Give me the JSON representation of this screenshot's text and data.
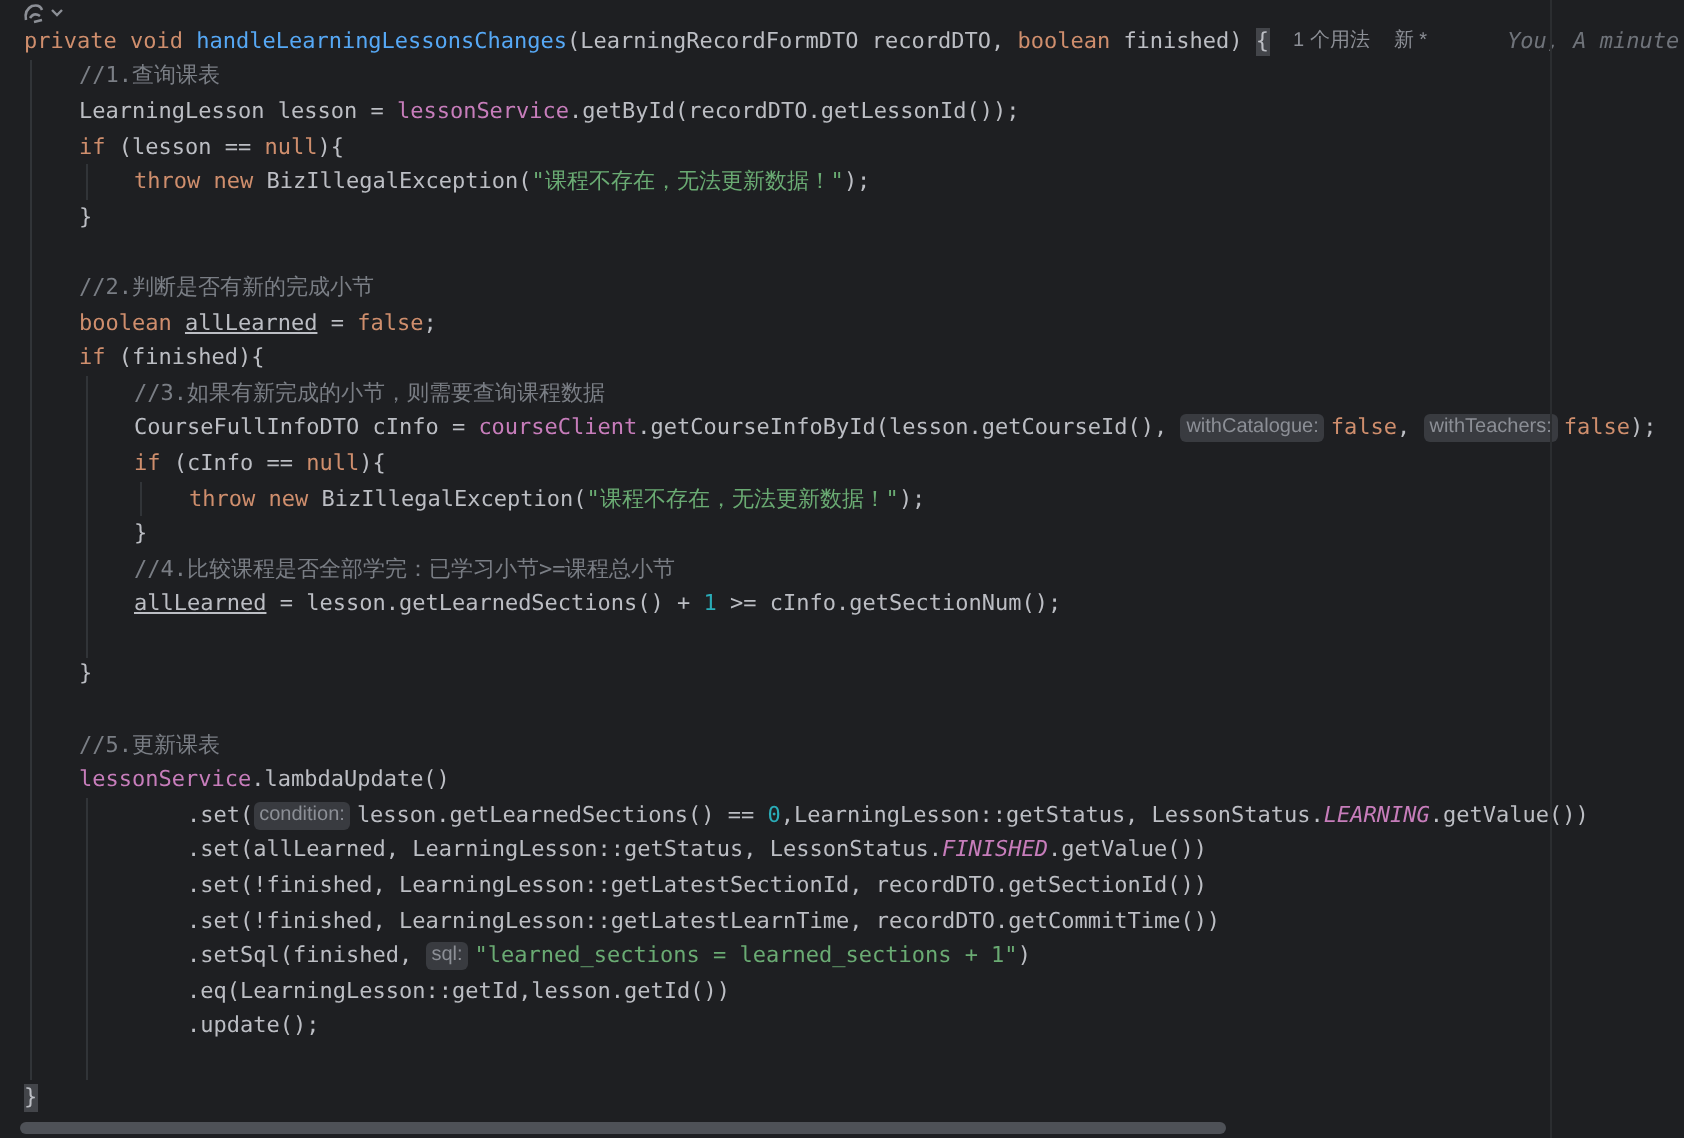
{
  "lines": [
    {
      "tokens": [
        {
          "kind": "kw",
          "text": "private void "
        },
        {
          "kind": "fn",
          "text": "handleLearningLessonsChanges"
        },
        {
          "kind": "plain",
          "text": "(LearningRecordFormDTO recordDTO, "
        },
        {
          "kind": "kw",
          "text": "boolean "
        },
        {
          "kind": "plain",
          "text": "finished) "
        },
        {
          "kind": "brace",
          "text": "{"
        },
        {
          "kind": "lens",
          "text": "1 个用法"
        },
        {
          "kind": "lens",
          "text": "新 *"
        },
        {
          "kind": "blame",
          "text": "You, A minute"
        }
      ],
      "children": [
        {
          "tokens": [
            {
              "kind": "cmt",
              "text": "//1.查询课表"
            }
          ]
        },
        {
          "tokens": [
            {
              "kind": "plain",
              "text": "LearningLesson lesson = "
            },
            {
              "kind": "field",
              "text": "lessonService"
            },
            {
              "kind": "plain",
              "text": ".getById(recordDTO.getLessonId());"
            }
          ]
        },
        {
          "tokens": [
            {
              "kind": "kw",
              "text": "if "
            },
            {
              "kind": "plain",
              "text": "(lesson == "
            },
            {
              "kind": "kw",
              "text": "null"
            },
            {
              "kind": "plain",
              "text": "){"
            }
          ],
          "children": [
            {
              "tokens": [
                {
                  "kind": "kw",
                  "text": "throw new "
                },
                {
                  "kind": "plain",
                  "text": "BizIllegalException("
                },
                {
                  "kind": "str",
                  "text": "\"课程不存在，无法更新数据！\""
                },
                {
                  "kind": "plain",
                  "text": ");"
                }
              ]
            }
          ]
        },
        {
          "tokens": [
            {
              "kind": "plain",
              "text": "}"
            }
          ]
        },
        {
          "kind": "blank"
        },
        {
          "tokens": [
            {
              "kind": "cmt",
              "text": "//2.判断是否有新的完成小节"
            }
          ]
        },
        {
          "tokens": [
            {
              "kind": "kw",
              "text": "boolean "
            },
            {
              "kind": "var",
              "text": "allLearned"
            },
            {
              "kind": "plain",
              "text": " = "
            },
            {
              "kind": "kw",
              "text": "false"
            },
            {
              "kind": "plain",
              "text": ";"
            }
          ]
        },
        {
          "tokens": [
            {
              "kind": "kw",
              "text": "if "
            },
            {
              "kind": "plain",
              "text": "(finished){"
            }
          ],
          "children": [
            {
              "tokens": [
                {
                  "kind": "cmt",
                  "text": "//3.如果有新完成的小节，则需要查询课程数据"
                }
              ]
            },
            {
              "tokens": [
                {
                  "kind": "plain",
                  "text": "CourseFullInfoDTO cInfo = "
                },
                {
                  "kind": "field",
                  "text": "courseClient"
                },
                {
                  "kind": "plain",
                  "text": ".getCourseInfoById(lesson.getCourseId(), "
                },
                {
                  "kind": "hint",
                  "text": "withCatalogue:"
                },
                {
                  "kind": "kw",
                  "text": "false"
                },
                {
                  "kind": "plain",
                  "text": ", "
                },
                {
                  "kind": "hint",
                  "text": "withTeachers:"
                },
                {
                  "kind": "kw",
                  "text": "false"
                },
                {
                  "kind": "plain",
                  "text": ");"
                }
              ]
            },
            {
              "tokens": [
                {
                  "kind": "kw",
                  "text": "if "
                },
                {
                  "kind": "plain",
                  "text": "(cInfo == "
                },
                {
                  "kind": "kw",
                  "text": "null"
                },
                {
                  "kind": "plain",
                  "text": "){"
                }
              ],
              "children": [
                {
                  "tokens": [
                    {
                      "kind": "kw",
                      "text": "throw new "
                    },
                    {
                      "kind": "plain",
                      "text": "BizIllegalException("
                    },
                    {
                      "kind": "str",
                      "text": "\"课程不存在，无法更新数据！\""
                    },
                    {
                      "kind": "plain",
                      "text": ");"
                    }
                  ]
                }
              ]
            },
            {
              "tokens": [
                {
                  "kind": "plain",
                  "text": "}"
                }
              ]
            },
            {
              "tokens": [
                {
                  "kind": "cmt",
                  "text": "//4.比较课程是否全部学完：已学习小节>=课程总小节"
                }
              ]
            },
            {
              "tokens": [
                {
                  "kind": "var",
                  "text": "allLearned"
                },
                {
                  "kind": "plain",
                  "text": " = lesson.getLearnedSections() + "
                },
                {
                  "kind": "num",
                  "text": "1"
                },
                {
                  "kind": "plain",
                  "text": " >= cInfo.getSectionNum();"
                }
              ]
            },
            {
              "kind": "blank"
            }
          ]
        },
        {
          "tokens": [
            {
              "kind": "plain",
              "text": "}"
            }
          ]
        },
        {
          "kind": "blank"
        },
        {
          "tokens": [
            {
              "kind": "cmt",
              "text": "//5.更新课表"
            }
          ]
        },
        {
          "kind": "continuation",
          "tokens": [
            {
              "kind": "field",
              "text": "lessonService"
            },
            {
              "kind": "plain",
              "text": ".lambdaUpdate()"
            }
          ],
          "children": [
            {
              "tokens": [
                {
                  "kind": "plain",
                  "text": ".set("
                },
                {
                  "kind": "hint",
                  "text": "condition:"
                },
                {
                  "kind": "plain",
                  "text": "lesson.getLearnedSections() == "
                },
                {
                  "kind": "num",
                  "text": "0"
                },
                {
                  "kind": "plain",
                  "text": ",LearningLesson::getStatus, LessonStatus."
                },
                {
                  "kind": "const",
                  "text": "LEARNING"
                },
                {
                  "kind": "plain",
                  "text": ".getValue())"
                }
              ]
            },
            {
              "tokens": [
                {
                  "kind": "plain",
                  "text": ".set(allLearned, LearningLesson::getStatus, LessonStatus."
                },
                {
                  "kind": "const",
                  "text": "FINISHED"
                },
                {
                  "kind": "plain",
                  "text": ".getValue())"
                }
              ]
            },
            {
              "tokens": [
                {
                  "kind": "plain",
                  "text": ".set(!finished, LearningLesson::getLatestSectionId, recordDTO.getSectionId())"
                }
              ]
            },
            {
              "tokens": [
                {
                  "kind": "plain",
                  "text": ".set(!finished, LearningLesson::getLatestLearnTime, recordDTO.getCommitTime())"
                }
              ]
            },
            {
              "tokens": [
                {
                  "kind": "plain",
                  "text": ".setSql(finished, "
                },
                {
                  "kind": "hint",
                  "text": "sql:"
                },
                {
                  "kind": "str",
                  "text": "\"learned_sections = learned_sections + 1\""
                },
                {
                  "kind": "plain",
                  "text": ")"
                }
              ]
            },
            {
              "tokens": [
                {
                  "kind": "plain",
                  "text": ".eq(LearningLesson::getId,lesson.getId())"
                }
              ]
            },
            {
              "tokens": [
                {
                  "kind": "plain",
                  "text": ".update();"
                }
              ]
            },
            {
              "kind": "blank"
            }
          ]
        }
      ]
    },
    {
      "tokens": [
        {
          "kind": "brace",
          "text": "}"
        }
      ]
    }
  ]
}
